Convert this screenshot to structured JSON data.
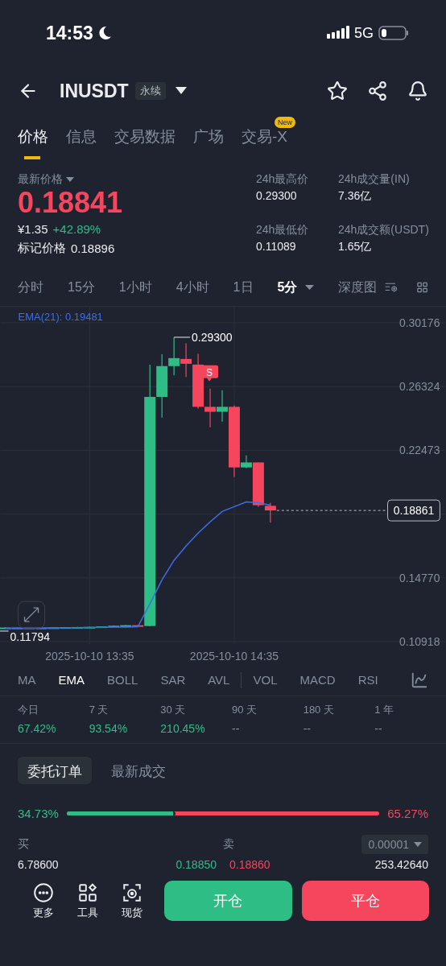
{
  "status_bar": {
    "time": "14:53",
    "network": "5G"
  },
  "header": {
    "symbol": "INUSDT",
    "contract_type": "永续"
  },
  "tabs": [
    {
      "label": "价格",
      "selected": true
    },
    {
      "label": "信息",
      "selected": false
    },
    {
      "label": "交易数据",
      "selected": false
    },
    {
      "label": "广场",
      "selected": false
    },
    {
      "label": "交易-X",
      "selected": false,
      "badge": "New"
    }
  ],
  "price": {
    "label": "最新价格",
    "last": "0.18841",
    "cny": "¥1.35",
    "change": "+42.89%",
    "mark_label": "标记价格",
    "mark": "0.18896"
  },
  "stats": [
    {
      "label": "24h最高价",
      "value": "0.29300"
    },
    {
      "label": "24h成交量(IN)",
      "value": "7.36亿"
    },
    {
      "label": "24h最低价",
      "value": "0.11089"
    },
    {
      "label": "24h成交额(USDT)",
      "value": "1.65亿"
    }
  ],
  "timeframes": [
    {
      "label": "分时",
      "selected": false
    },
    {
      "label": "15分",
      "selected": false
    },
    {
      "label": "1小时",
      "selected": false
    },
    {
      "label": "4小时",
      "selected": false
    },
    {
      "label": "1日",
      "selected": false
    },
    {
      "label": "5分",
      "selected": true
    }
  ],
  "depth_chart": "深度图",
  "chart": {
    "indicator_value": ": 0.19481",
    "high_label": "0.29300",
    "low_label": "0.11794",
    "price_tag": "0.18861",
    "signal": "S",
    "time_labels": [
      "2025-10-10 13:35",
      "2025-10-10 14:35"
    ],
    "chart_data": {
      "type": "line",
      "grid": true,
      "ylim": [
        0.10918,
        0.30176
      ],
      "yticks": [
        {
          "value": 0.30176,
          "label": "0.30176"
        },
        {
          "value": 0.26324,
          "label": "0.26324"
        },
        {
          "value": 0.22473,
          "label": "0.22473"
        },
        {
          "value": 0.1477,
          "label": "0.14770"
        },
        {
          "value": 0.10918,
          "label": "0.10918"
        }
      ],
      "series": [
        {
          "name": "EMA(21)",
          "color": "#3b6fe6",
          "values": [
            0.1172,
            0.1173,
            0.1173,
            0.1174,
            0.1175,
            0.1175,
            0.1176,
            0.1177,
            0.1178,
            0.1179,
            0.118,
            0.1182,
            0.132,
            0.1465,
            0.1582,
            0.1669,
            0.1747,
            0.1815,
            0.1878,
            0.1907,
            0.1936,
            0.1931,
            0.1916
          ]
        }
      ]
    }
  },
  "main_indicators": [
    {
      "label": "MA",
      "selected": false
    },
    {
      "label": "EMA",
      "selected": true
    },
    {
      "label": "BOLL",
      "selected": false
    },
    {
      "label": "SAR",
      "selected": false
    },
    {
      "label": "AVL",
      "selected": false
    }
  ],
  "sub_indicators": [
    {
      "label": "VOL",
      "selected": false
    },
    {
      "label": "MACD",
      "selected": false
    },
    {
      "label": "RSI",
      "selected": false
    }
  ],
  "returns": [
    {
      "period": "今日",
      "value": "67.42%",
      "color": "#2ebd85"
    },
    {
      "period": "7 天",
      "value": "93.54%",
      "color": "#2ebd85"
    },
    {
      "period": "30 天",
      "value": "210.45%",
      "color": "#2ebd85"
    },
    {
      "period": "90 天",
      "value": "--",
      "color": "#848e9c"
    },
    {
      "period": "180 天",
      "value": "--",
      "color": "#848e9c"
    },
    {
      "period": "1 年",
      "value": "--",
      "color": "#848e9c"
    }
  ],
  "order_tabs": [
    {
      "label": "委托订单",
      "selected": true
    },
    {
      "label": "最新成交",
      "selected": false
    }
  ],
  "ratio": {
    "buy": "34.73%",
    "sell": "65.27%",
    "level": 0.3473
  },
  "book": {
    "buy_label": "买",
    "sell_label": "卖",
    "step": "0.00001",
    "rows": [
      {
        "buy_qty": "6.78600",
        "buy_price": "0.18850",
        "sell_price": "0.18860",
        "sell_qty": "253.42640"
      }
    ]
  },
  "actions": [
    {
      "kind": "more",
      "label": "更多"
    },
    {
      "kind": "tools",
      "label": "工具"
    },
    {
      "kind": "spot",
      "label": "现货"
    }
  ],
  "buttons": [
    {
      "kind": "open",
      "label": "开仓"
    },
    {
      "kind": "close",
      "label": "平仓"
    }
  ]
}
